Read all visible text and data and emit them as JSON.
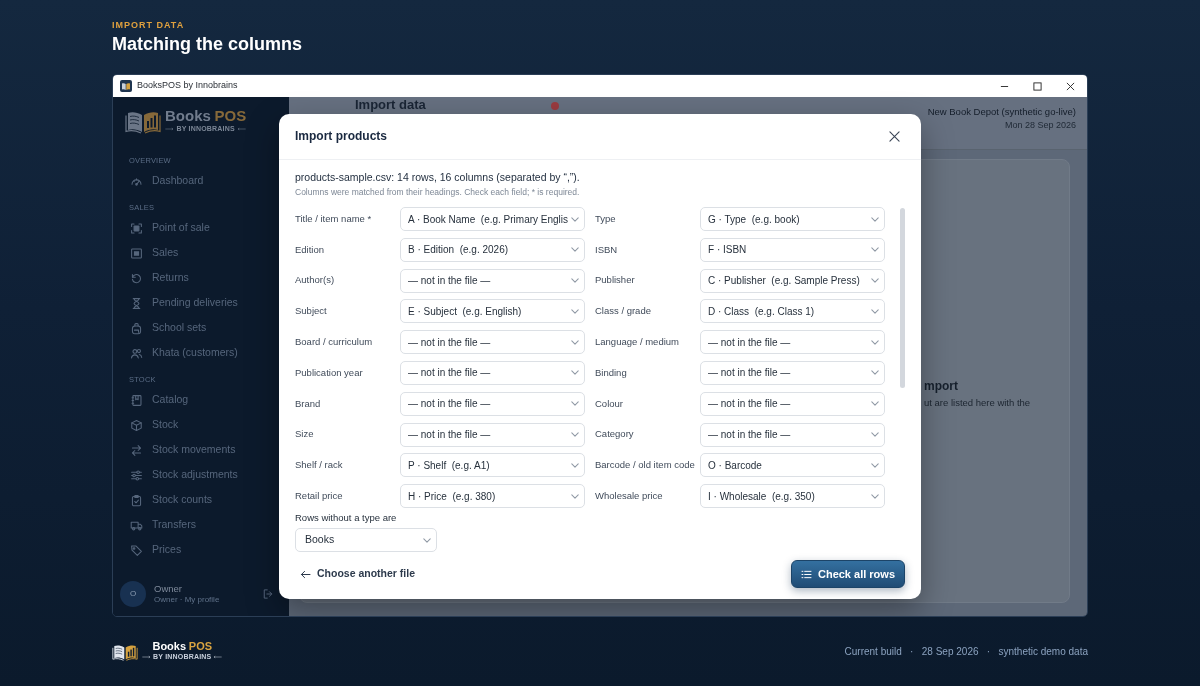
{
  "page_header": {
    "eyebrow": "IMPORT DATA",
    "title": "Matching the columns"
  },
  "window": {
    "title": "BooksPOS by Innobrains"
  },
  "sidebar": {
    "logo": {
      "name": "Books",
      "accent": "POS",
      "tagline": "BY INNOBRAINS"
    },
    "sections": [
      {
        "heading": "OVERVIEW",
        "items": [
          {
            "label": "Dashboard"
          }
        ]
      },
      {
        "heading": "SALES",
        "items": [
          {
            "label": "Point of sale"
          },
          {
            "label": "Sales"
          },
          {
            "label": "Returns"
          },
          {
            "label": "Pending deliveries"
          },
          {
            "label": "School sets"
          },
          {
            "label": "Khata (customers)"
          }
        ]
      },
      {
        "heading": "STOCK",
        "items": [
          {
            "label": "Catalog"
          },
          {
            "label": "Stock"
          },
          {
            "label": "Stock movements"
          },
          {
            "label": "Stock adjustments"
          },
          {
            "label": "Stock counts"
          },
          {
            "label": "Transfers"
          },
          {
            "label": "Prices"
          }
        ]
      }
    ],
    "user": {
      "initial": "O",
      "name": "Owner",
      "subtitle": "Owner · My profile"
    }
  },
  "main": {
    "heading": "Import data",
    "store": "New Book Depot (synthetic go-live)",
    "date": "Mon 28 Sep 2026",
    "panel": {
      "title": "mport",
      "text": "ut are listed here with the"
    }
  },
  "dialog": {
    "title": "Import products",
    "summary": "products-sample.csv: 14 rows, 16 columns (separated by “,”).",
    "hint": "Columns were matched from their headings. Check each field; * is required.",
    "fields": [
      {
        "label": "Title / item name *",
        "value": "A · Book Name  (e.g. Primary Englis"
      },
      {
        "label": "Type",
        "value": "G · Type  (e.g. book)"
      },
      {
        "label": "Edition",
        "value": "B · Edition  (e.g. 2026)"
      },
      {
        "label": "ISBN",
        "value": "F · ISBN"
      },
      {
        "label": "Author(s)",
        "value": "— not in the file —"
      },
      {
        "label": "Publisher",
        "value": "C · Publisher  (e.g. Sample Press)"
      },
      {
        "label": "Subject",
        "value": "E · Subject  (e.g. English)"
      },
      {
        "label": "Class / grade",
        "value": "D · Class  (e.g. Class 1)"
      },
      {
        "label": "Board / curriculum",
        "value": "— not in the file —"
      },
      {
        "label": "Language / medium",
        "value": "— not in the file —"
      },
      {
        "label": "Publication year",
        "value": "— not in the file —"
      },
      {
        "label": "Binding",
        "value": "— not in the file —"
      },
      {
        "label": "Brand",
        "value": "— not in the file —"
      },
      {
        "label": "Colour",
        "value": "— not in the file —"
      },
      {
        "label": "Size",
        "value": "— not in the file —"
      },
      {
        "label": "Category",
        "value": "— not in the file —"
      },
      {
        "label": "Shelf / rack",
        "value": "P · Shelf  (e.g. A1)"
      },
      {
        "label": "Barcode / old item code",
        "value": "O · Barcode"
      },
      {
        "label": "Retail price",
        "value": "H · Price  (e.g. 380)"
      },
      {
        "label": "Wholesale price",
        "value": "I · Wholesale  (e.g. 350)"
      }
    ],
    "default_type": {
      "label": "Rows without a type are",
      "value": "Books"
    },
    "back_link": "Choose another file",
    "submit": "Check all rows"
  },
  "footer": {
    "logo": {
      "name": "Books",
      "accent": "POS",
      "tagline": "BY INNOBRAINS"
    },
    "text": "Current build   ·   28 Sep 2026   ·   synthetic demo data"
  }
}
